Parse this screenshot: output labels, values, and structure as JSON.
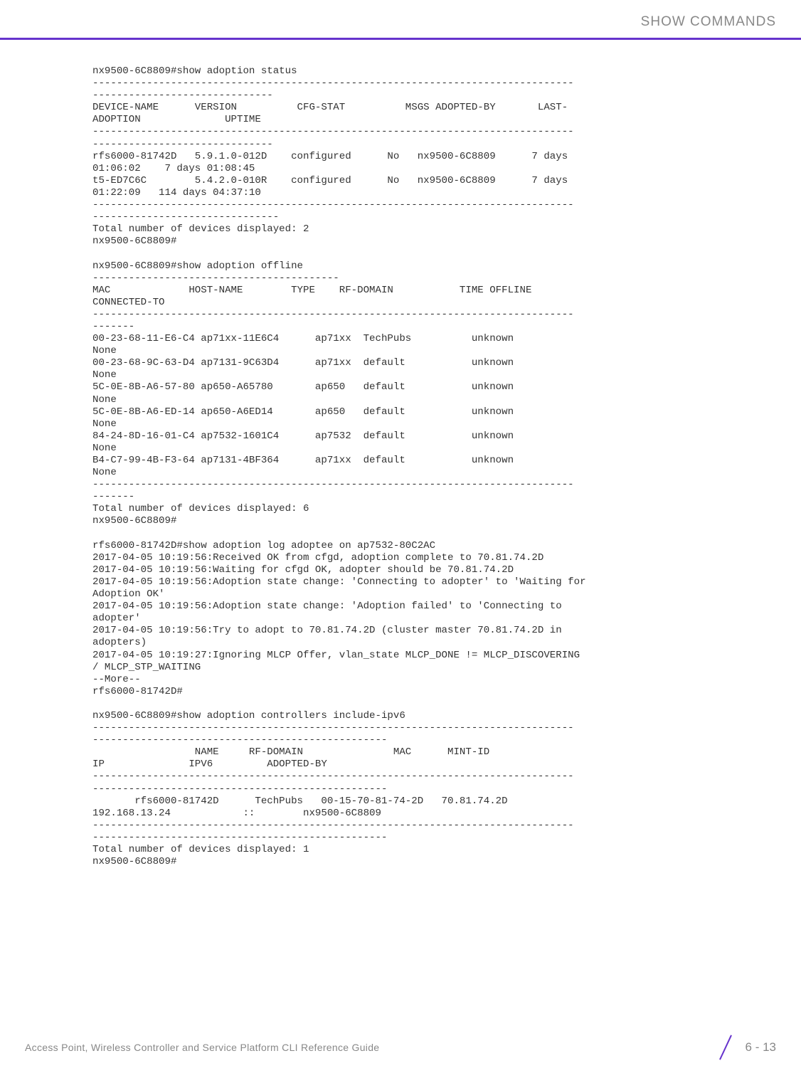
{
  "header": {
    "section_title": "SHOW COMMANDS"
  },
  "terminal": {
    "content": "nx9500-6C8809#show adoption status\n--------------------------------------------------------------------------------\n------------------------------\nDEVICE-NAME      VERSION          CFG-STAT          MSGS ADOPTED-BY       LAST-\nADOPTION              UPTIME\n--------------------------------------------------------------------------------\n------------------------------\nrfs6000-81742D   5.9.1.0-012D    configured      No   nx9500-6C8809      7 days \n01:06:02    7 days 01:08:45\nt5-ED7C6C        5.4.2.0-010R    configured      No   nx9500-6C8809      7 days \n01:22:09   114 days 04:37:10\n--------------------------------------------------------------------------------\n-------------------------------\nTotal number of devices displayed: 2\nnx9500-6C8809#\n\nnx9500-6C8809#show adoption offline\n-----------------------------------------\nMAC             HOST-NAME        TYPE    RF-DOMAIN           TIME OFFLINE     \nCONNECTED-TO\n--------------------------------------------------------------------------------\n-------\n00-23-68-11-E6-C4 ap71xx-11E6C4      ap71xx  TechPubs          unknown          \nNone\n00-23-68-9C-63-D4 ap7131-9C63D4      ap71xx  default           unknown          \nNone\n5C-0E-8B-A6-57-80 ap650-A65780       ap650   default           unknown          \nNone\n5C-0E-8B-A6-ED-14 ap650-A6ED14       ap650   default           unknown          \nNone\n84-24-8D-16-01-C4 ap7532-1601C4      ap7532  default           unknown          \nNone\nB4-C7-99-4B-F3-64 ap7131-4BF364      ap71xx  default           unknown          \nNone\n--------------------------------------------------------------------------------\n-------\nTotal number of devices displayed: 6\nnx9500-6C8809#\n\nrfs6000-81742D#show adoption log adoptee on ap7532-80C2AC\n2017-04-05 10:19:56:Received OK from cfgd, adoption complete to 70.81.74.2D\n2017-04-05 10:19:56:Waiting for cfgd OK, adopter should be 70.81.74.2D\n2017-04-05 10:19:56:Adoption state change: 'Connecting to adopter' to 'Waiting for \nAdoption OK'\n2017-04-05 10:19:56:Adoption state change: 'Adoption failed' to 'Connecting to \nadopter'\n2017-04-05 10:19:56:Try to adopt to 70.81.74.2D (cluster master 70.81.74.2D in \nadopters)\n2017-04-05 10:19:27:Ignoring MLCP Offer, vlan_state MLCP_DONE != MLCP_DISCOVERING \n/ MLCP_STP_WAITING\n--More--\nrfs6000-81742D#\n\nnx9500-6C8809#show adoption controllers include-ipv6\n--------------------------------------------------------------------------------\n-------------------------------------------------\n                 NAME     RF-DOMAIN               MAC      MINT-ID               \nIP              IPV6         ADOPTED-BY\n--------------------------------------------------------------------------------\n-------------------------------------------------\n       rfs6000-81742D      TechPubs   00-15-70-81-74-2D   70.81.74.2D    \n192.168.13.24            ::        nx9500-6C8809\n--------------------------------------------------------------------------------\n-------------------------------------------------\nTotal number of devices displayed: 1\nnx9500-6C8809#"
  },
  "footer": {
    "guide_text": "Access Point, Wireless Controller and Service Platform CLI Reference Guide",
    "page_number": "6 - 13"
  }
}
